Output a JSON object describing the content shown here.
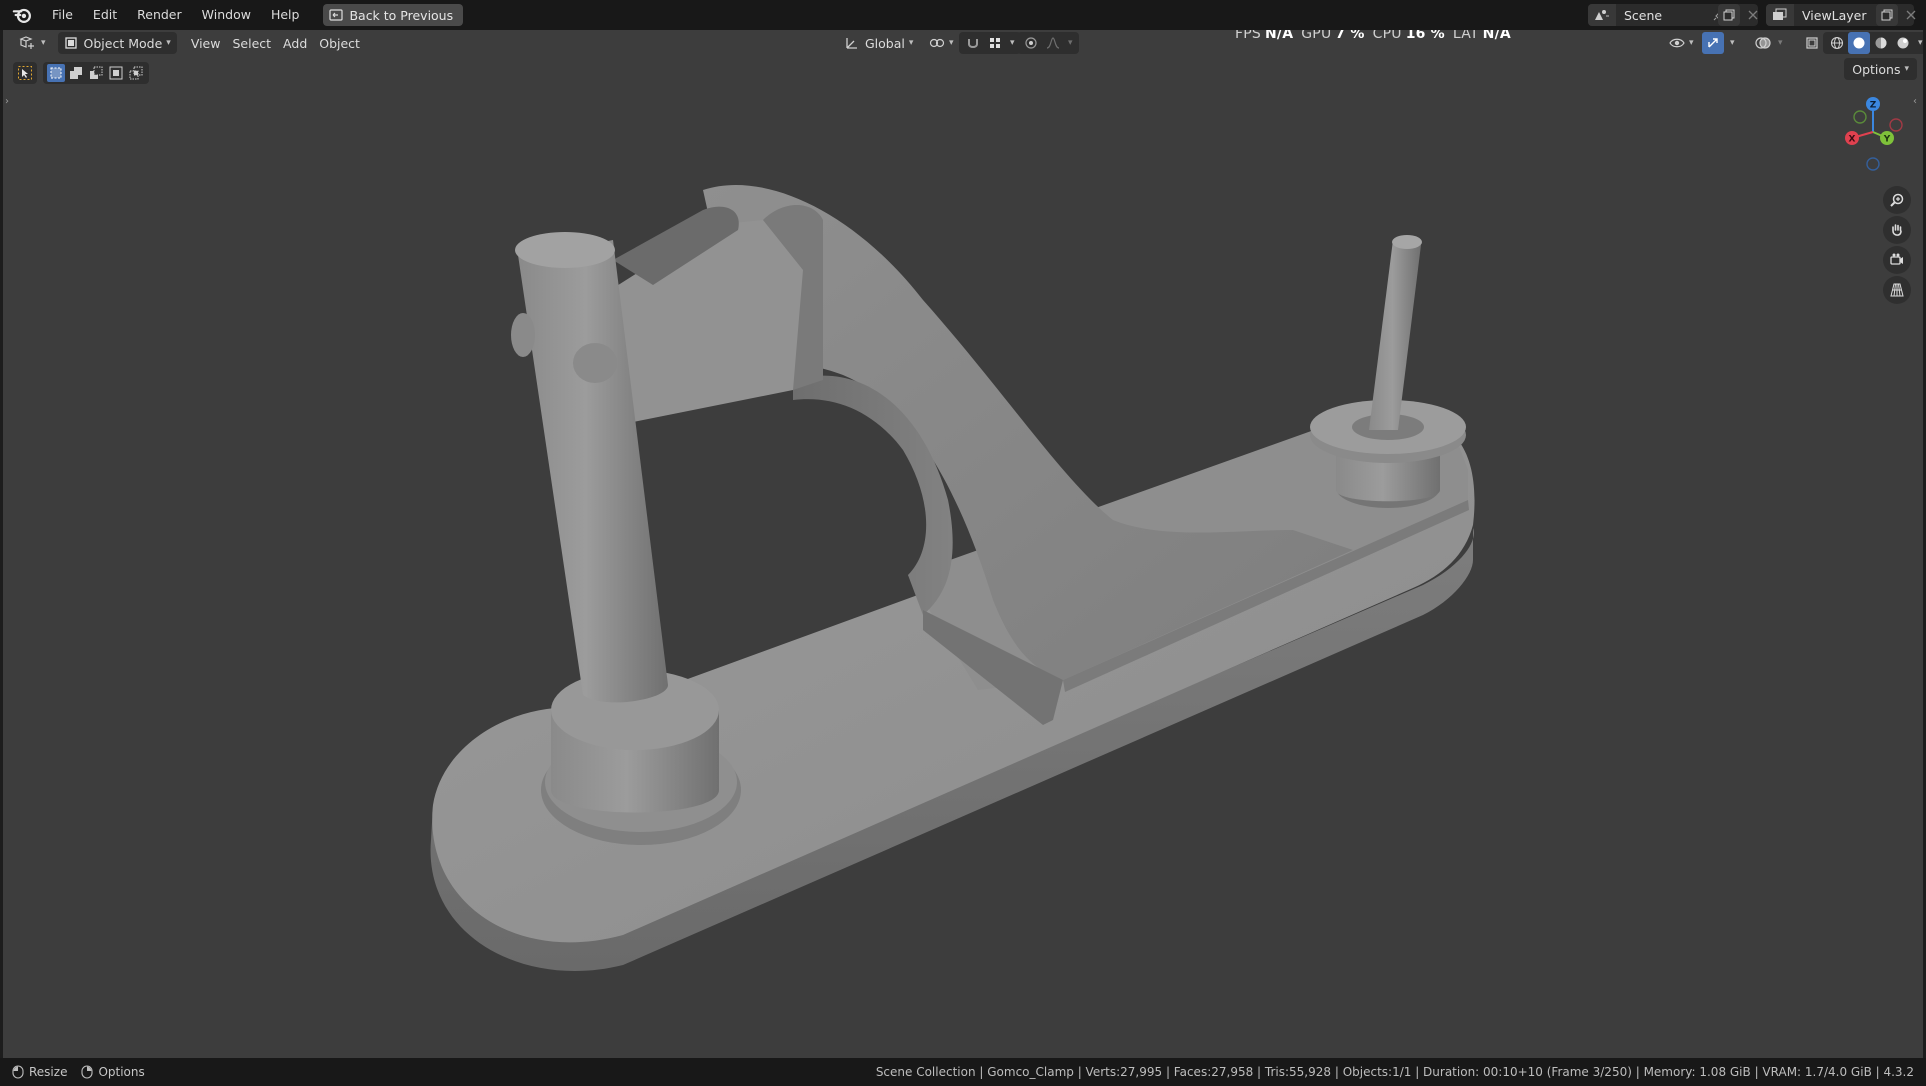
{
  "menu": {
    "items": [
      "File",
      "Edit",
      "Render",
      "Window",
      "Help"
    ],
    "back_label": "Back to Previous"
  },
  "scene": {
    "name": "Scene"
  },
  "view_layer": {
    "name": "ViewLayer"
  },
  "viewport_header": {
    "mode_label": "Object Mode",
    "menus": [
      "View",
      "Select",
      "Add",
      "Object"
    ],
    "orientation_label": "Global",
    "options_label": "Options"
  },
  "perf": {
    "fps_label": "FPS",
    "fps_value": "N/A",
    "gpu_label": "GPU",
    "gpu_value": "7 %",
    "cpu_label": "CPU",
    "cpu_value": "16 %",
    "lat_label": "LAT",
    "lat_value": "N/A"
  },
  "gizmo": {
    "x": "X",
    "y": "Y",
    "z": "Z"
  },
  "status": {
    "resize_label": "Resize",
    "options_label": "Options",
    "text": "Scene Collection | Gomco_Clamp | Verts:27,995 | Faces:27,958 | Tris:55,928 | Objects:1/1 | Duration: 00:10+10 (Frame 3/250) | Memory: 1.08 GiB | VRAM: 1.7/4.0 GiB | 4.3.2"
  },
  "colors": {
    "accent": "#4772b3",
    "axis_x": "#e0414f",
    "axis_y": "#7fc23a",
    "axis_z": "#3b87e0"
  }
}
